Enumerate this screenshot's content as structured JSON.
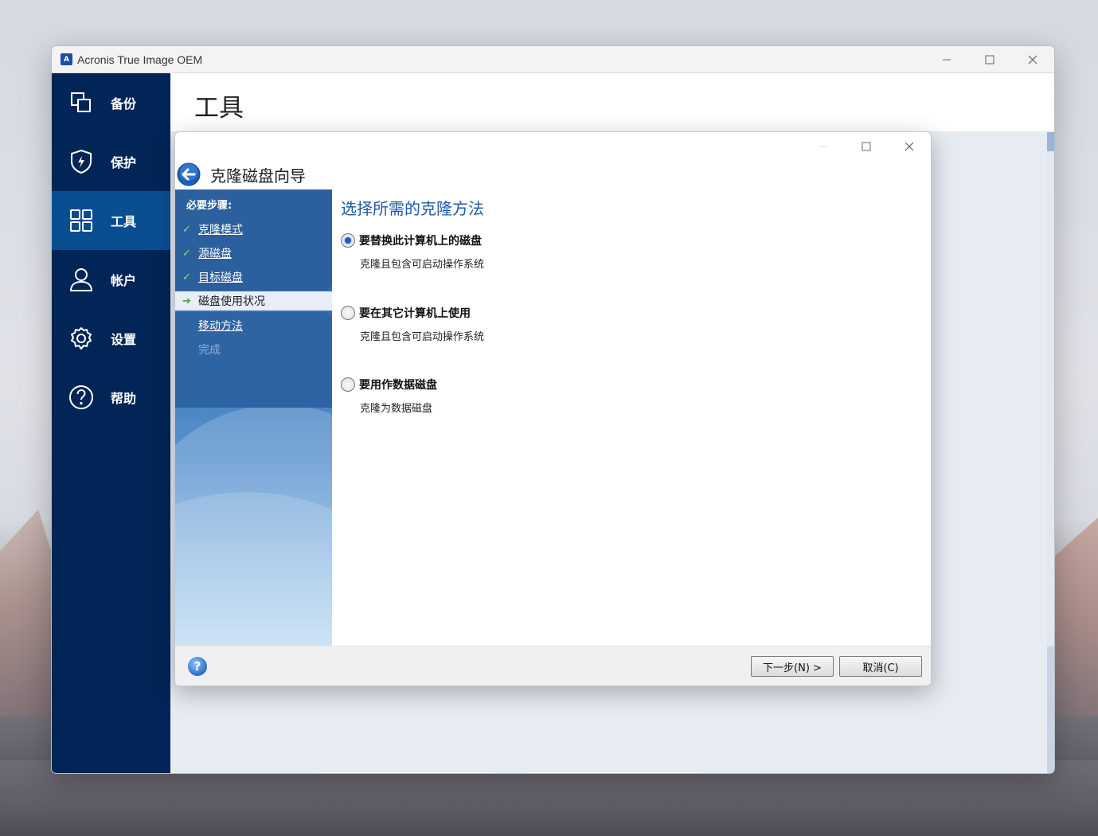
{
  "window": {
    "title": "Acronis True Image OEM",
    "app_icon_letter": "A"
  },
  "sidebar": {
    "items": [
      {
        "label": "备份",
        "icon": "backup-icon"
      },
      {
        "label": "保护",
        "icon": "shield-icon"
      },
      {
        "label": "工具",
        "icon": "tools-grid-icon",
        "active": true
      },
      {
        "label": "帐户",
        "icon": "user-icon"
      },
      {
        "label": "设置",
        "icon": "gear-icon"
      },
      {
        "label": "帮助",
        "icon": "help-circle-icon"
      }
    ]
  },
  "header": {
    "title": "工具"
  },
  "wizard": {
    "title": "克隆磁盘向导",
    "steps_heading": "必要步骤:",
    "steps": [
      {
        "label": "克隆模式",
        "state": "done"
      },
      {
        "label": "源磁盘",
        "state": "done"
      },
      {
        "label": "目标磁盘",
        "state": "done"
      },
      {
        "label": "磁盘使用状况",
        "state": "current"
      },
      {
        "label": "移动方法",
        "state": "pending"
      },
      {
        "label": "完成",
        "state": "disabled"
      }
    ],
    "pane_title": "选择所需的克隆方法",
    "options": [
      {
        "label": "要替换此计算机上的磁盘",
        "desc": "克隆且包含可启动操作系统",
        "selected": true
      },
      {
        "label": "要在其它计算机上使用",
        "desc": "克隆且包含可启动操作系统",
        "selected": false
      },
      {
        "label": "要用作数据磁盘",
        "desc": "克隆为数据磁盘",
        "selected": false
      }
    ],
    "buttons": {
      "next": "下一步(N) >",
      "cancel": "取消(C)"
    },
    "help_glyph": "?"
  },
  "colors": {
    "sidebar_bg": "#002556",
    "sidebar_active": "#0a4e92",
    "accent_title": "#1f5aa6",
    "check_green": "#7ee074"
  }
}
